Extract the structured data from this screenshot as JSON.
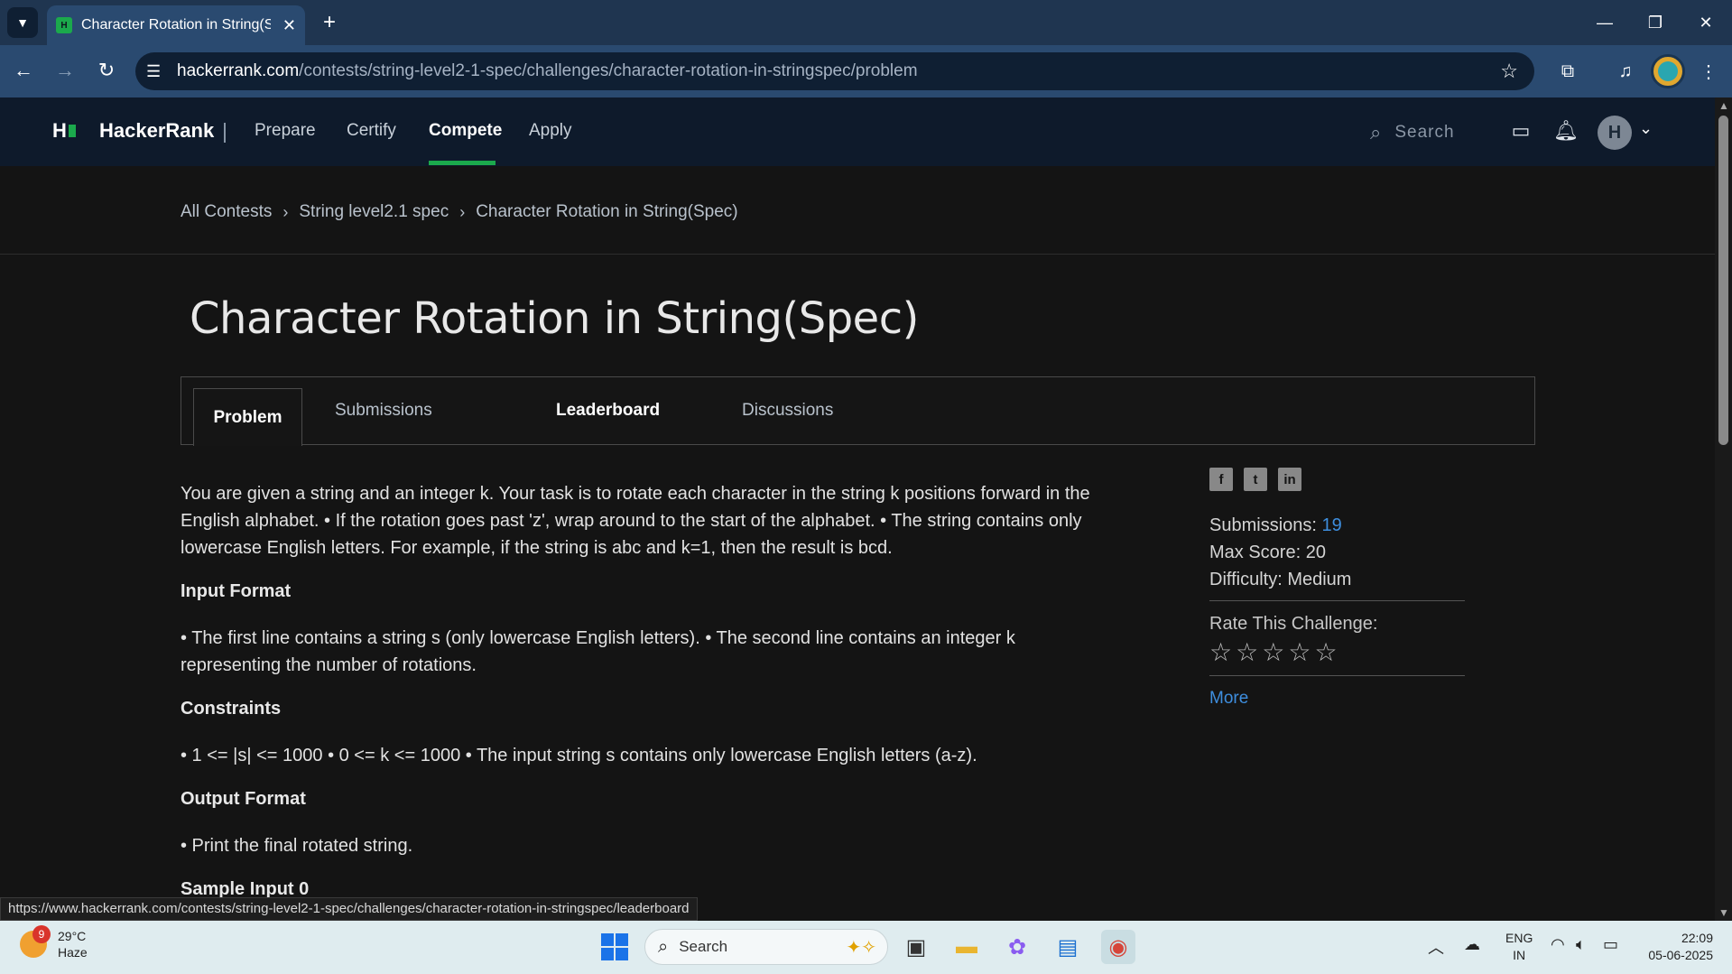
{
  "browser": {
    "tab_title": "Character Rotation in String(Spec)",
    "url_domain": "hackerrank.com",
    "url_path": "/contests/string-level2-1-spec/challenges/character-rotation-in-stringspec/problem",
    "status_url": "https://www.hackerrank.com/contests/string-level2-1-spec/challenges/character-rotation-in-stringspec/leaderboard"
  },
  "hrnav": {
    "brand": "HackerRank",
    "links": [
      "Prepare",
      "Certify",
      "Compete",
      "Apply"
    ],
    "active": "Compete",
    "search_placeholder": "Search",
    "avatar_letter": "H",
    "accent": "#1ba94c"
  },
  "breadcrumb": [
    "All Contests",
    "String level2.1 spec",
    "Character Rotation in String(Spec)"
  ],
  "page": {
    "title": "Character Rotation in String(Spec)",
    "tabs": [
      "Problem",
      "Submissions",
      "Leaderboard",
      "Discussions"
    ],
    "selected_tab": "Problem"
  },
  "statement": {
    "intro": "You are given a string and an integer k. Your task is to rotate each character in the string k positions forward in the English alphabet. • If the rotation goes past 'z', wrap around to the start of the alphabet. • The string contains only lowercase English letters. For example, if the string is abc and k=1, then the result is bcd.",
    "input_format_heading": "Input Format",
    "input_format": "• The first line contains a string s (only lowercase English letters). • The second line contains an integer k representing the number of rotations.",
    "constraints_heading": "Constraints",
    "constraints": "• 1 <= |s| <= 1000 • 0 <= k <= 1000 • The input string s contains only lowercase English letters (a-z).",
    "output_format_heading": "Output Format",
    "output_format": "• Print the final rotated string.",
    "sample_input_heading": "Sample Input 0"
  },
  "sidebar": {
    "share_icons": [
      "facebook-icon",
      "twitter-icon",
      "linkedin-icon"
    ],
    "submissions_label": "Submissions:",
    "submissions_value": "19",
    "max_score_label": "Max Score:",
    "max_score_value": "20",
    "difficulty_label": "Difficulty:",
    "difficulty_value": "Medium",
    "rate_label": "Rate This Challenge:",
    "stars": 5,
    "more_label": "More"
  },
  "taskbar": {
    "weather_temp": "29°C",
    "weather_desc": "Haze",
    "weather_badge": "9",
    "search_placeholder": "Search",
    "lang_line1": "ENG",
    "lang_line2": "IN",
    "time": "22:09",
    "date": "05-06-2025"
  }
}
